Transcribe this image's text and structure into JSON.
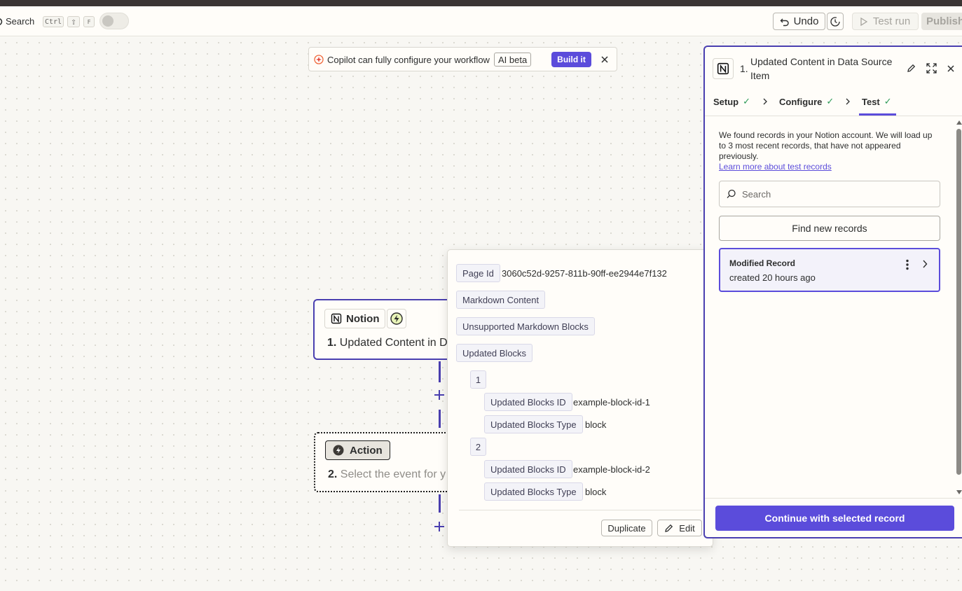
{
  "topbar": {
    "search_label": "Search",
    "shortcut_keys": [
      "Ctrl",
      "⇧",
      "F"
    ],
    "undo_label": "Undo",
    "test_run_label": "Test run",
    "publish_label": "Publish"
  },
  "copilot": {
    "text": "Copilot can fully configure your workflow",
    "badge": "AI beta",
    "build_label": "Build it"
  },
  "trigger_node": {
    "app_label": "Notion",
    "number": "1.",
    "title": "Updated Content in D"
  },
  "action_node": {
    "app_label": "Action",
    "number": "2.",
    "title": "Select the event for y"
  },
  "record_popup": {
    "fields": [
      {
        "label": "Page Id",
        "value": "3060c52d-9257-811b-90ff-ee2944e7f132"
      },
      {
        "label": "Markdown Content",
        "value": ""
      },
      {
        "label": "Unsupported Markdown Blocks",
        "value": ""
      },
      {
        "label": "Updated Blocks",
        "value": ""
      }
    ],
    "blocks": [
      {
        "index": "1",
        "id_label": "Updated Blocks ID",
        "id_value": "example-block-id-1",
        "type_label": "Updated Blocks Type",
        "type_value": "block"
      },
      {
        "index": "2",
        "id_label": "Updated Blocks ID",
        "id_value": "example-block-id-2",
        "type_label": "Updated Blocks Type",
        "type_value": "block"
      }
    ],
    "duplicate_label": "Duplicate",
    "edit_label": "Edit"
  },
  "panel": {
    "step_number": "1.",
    "title_line1": "Updated Content in Data Source",
    "title_line2": "Item",
    "tabs": [
      {
        "label": "Setup",
        "check": "✓"
      },
      {
        "label": "Configure",
        "check": "✓"
      },
      {
        "label": "Test",
        "check": "✓"
      }
    ],
    "description": "We found records in your Notion account. We will load up to 3 most recent records, that have not appeared previously.",
    "learn_more_link": "Learn more about test records",
    "search_placeholder": "Search",
    "find_new_label": "Find new records",
    "record_title": "Modified Record",
    "record_subtitle": "created 20 hours ago",
    "continue_label": "Continue with selected record"
  },
  "colors": {
    "accent": "#5b4cdb",
    "success": "#2e9a58",
    "node_border": "#4a3fb0"
  }
}
